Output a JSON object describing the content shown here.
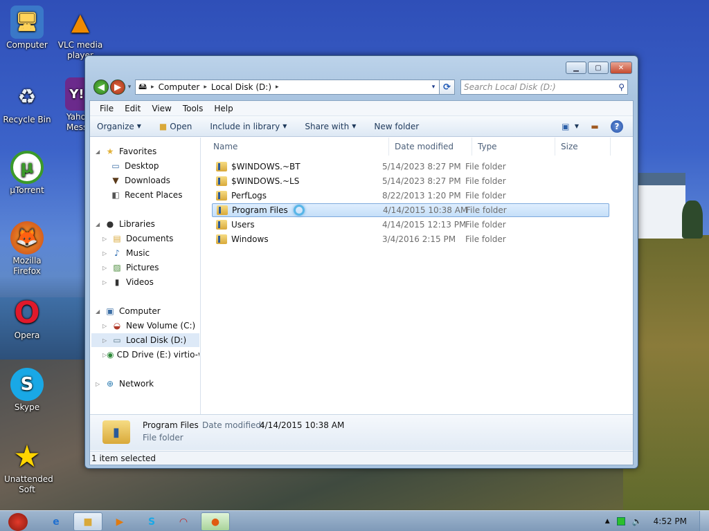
{
  "desktop": {
    "icons": [
      {
        "label": "Computer",
        "icon": "computer-icon",
        "glyph": "🖥"
      },
      {
        "label": "VLC media player",
        "icon": "vlc-icon",
        "glyph": "▲"
      },
      {
        "label": "Recycle Bin",
        "icon": "recycle-bin-icon",
        "glyph": "♻"
      },
      {
        "label": "Yahoo! Messenger",
        "icon": "yahoo-messenger-icon",
        "glyph": "Y!"
      },
      {
        "label": "µTorrent",
        "icon": "utorrent-icon",
        "glyph": "µ"
      },
      {
        "label": "Mozilla Firefox",
        "icon": "firefox-icon",
        "glyph": "🦊"
      },
      {
        "label": "Opera",
        "icon": "opera-icon",
        "glyph": "O"
      },
      {
        "label": "Skype",
        "icon": "skype-icon",
        "glyph": "S"
      },
      {
        "label": "Unattended Soft",
        "icon": "star-icon",
        "glyph": "★"
      }
    ]
  },
  "window": {
    "caption_buttons": {
      "minimize": "▁",
      "maximize": "▢",
      "close": "✕"
    },
    "nav": {
      "back": "◀",
      "forward": "▶",
      "history_dropdown": "▾"
    },
    "address": {
      "crumbs": [
        "Computer",
        "Local Disk (D:)"
      ],
      "separator": "▸",
      "dropdown": "▾"
    },
    "refresh": "⟳",
    "search": {
      "placeholder": "Search Local Disk (D:)",
      "icon": "⚲"
    },
    "menu": [
      "File",
      "Edit",
      "View",
      "Tools",
      "Help"
    ],
    "toolbar": {
      "organize": "Organize",
      "open": "Open",
      "include_in_library": "Include in library",
      "share_with": "Share with",
      "new_folder": "New folder",
      "dropdown_arrow": "▼",
      "help": "?"
    },
    "navpane": {
      "favorites": {
        "label": "Favorites",
        "items": [
          "Desktop",
          "Downloads",
          "Recent Places"
        ]
      },
      "libraries": {
        "label": "Libraries",
        "items": [
          "Documents",
          "Music",
          "Pictures",
          "Videos"
        ]
      },
      "computer": {
        "label": "Computer",
        "items": [
          "New Volume (C:)",
          "Local Disk (D:)",
          "CD Drive (E:) virtio-win"
        ]
      },
      "network": {
        "label": "Network"
      },
      "expanded_arrow": "◢",
      "collapsed_arrow": "▷"
    },
    "columns": {
      "name": "Name",
      "date_modified": "Date modified",
      "type": "Type",
      "size": "Size"
    },
    "files": [
      {
        "name": "$WINDOWS.~BT",
        "date": "5/14/2023 8:27 PM",
        "type": "File folder"
      },
      {
        "name": "$WINDOWS.~LS",
        "date": "5/14/2023 8:27 PM",
        "type": "File folder"
      },
      {
        "name": "PerfLogs",
        "date": "8/22/2013 1:20 PM",
        "type": "File folder"
      },
      {
        "name": "Program Files",
        "date": "4/14/2015 10:38 AM",
        "type": "File folder"
      },
      {
        "name": "Users",
        "date": "4/14/2015 12:13 PM",
        "type": "File folder"
      },
      {
        "name": "Windows",
        "date": "3/4/2016 2:15 PM",
        "type": "File folder"
      }
    ],
    "details": {
      "name": "Program Files",
      "date_label": "Date modified:",
      "date_value": "4/14/2015 10:38 AM",
      "type": "File folder"
    },
    "status": "1 item selected"
  },
  "taskbar": {
    "clock": "4:52 PM",
    "tray_arrow": "▲"
  },
  "colors": {
    "selection": "#c5dff8",
    "window_frame": "#a9c4e0",
    "taskbar": "#8aa3bf"
  }
}
